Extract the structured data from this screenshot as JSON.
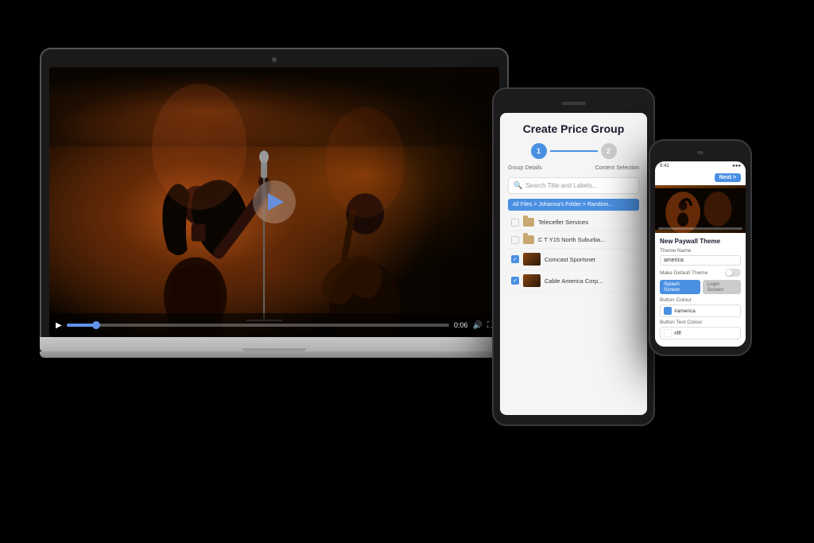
{
  "scene": {
    "background_color": "#000000"
  },
  "laptop": {
    "video": {
      "playing": false,
      "time_current": "0:06",
      "progress_percent": 8
    }
  },
  "tablet": {
    "title": "Create Price Group",
    "stepper": {
      "step1_label": "Group Details",
      "step2_label": "Content Selection",
      "step1_number": "1",
      "step2_number": "2"
    },
    "search_placeholder": "Search Title and Labels...",
    "breadcrumb": "All Files > Johanna's Folder > Random...",
    "files": [
      {
        "name": "Telecelfer Services",
        "type": "folder",
        "checked": false
      },
      {
        "name": "C T Y15 North Suburba...",
        "type": "folder",
        "checked": false
      },
      {
        "name": "Comcast Sportsnet",
        "type": "video",
        "checked": true
      },
      {
        "name": "Cable America Corp...",
        "type": "video",
        "checked": true
      }
    ]
  },
  "phone": {
    "status_bar": {
      "time": "9:41",
      "signal": "●●●",
      "battery": "■■■"
    },
    "header": {
      "next_button": "Next >"
    },
    "section": {
      "title": "New Paywall Theme",
      "theme_name_label": "Theme Name",
      "theme_name_placeholder": "america",
      "make_default_label": "Make Default Theme",
      "button_color_label": "Button Colour",
      "button_color_value": "#america",
      "button_text_color_label": "Button Text Colour",
      "button_text_color_value": "#fff",
      "screen_tabs": [
        "Splash Screen",
        "Login Screen"
      ]
    }
  }
}
